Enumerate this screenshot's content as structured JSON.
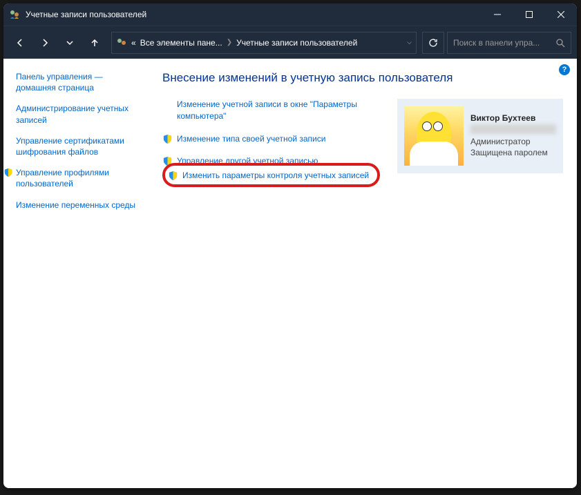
{
  "window": {
    "title": "Учетные записи пользователей"
  },
  "breadcrumb": {
    "prefix": "«",
    "item1": "Все элементы пане...",
    "item2": "Учетные записи пользователей"
  },
  "search": {
    "placeholder": "Поиск в панели упра..."
  },
  "sidebar": {
    "items": [
      "Панель управления — домашняя страница",
      "Администрирование учетных записей",
      "Управление сертификатами шифрования файлов",
      "Управление профилями пользователей",
      "Изменение переменных среды"
    ]
  },
  "main": {
    "heading": "Внесение изменений в учетную запись пользователя",
    "links": [
      "Изменение учетной записи в окне \"Параметры компьютера\"",
      "Изменение типа своей учетной записи",
      "Управление другой учетной записью",
      "Изменить параметры контроля учетных записей"
    ]
  },
  "user": {
    "name": "Виктор Бухтеев",
    "role1": "Администратор",
    "role2": "Защищена паролем"
  }
}
